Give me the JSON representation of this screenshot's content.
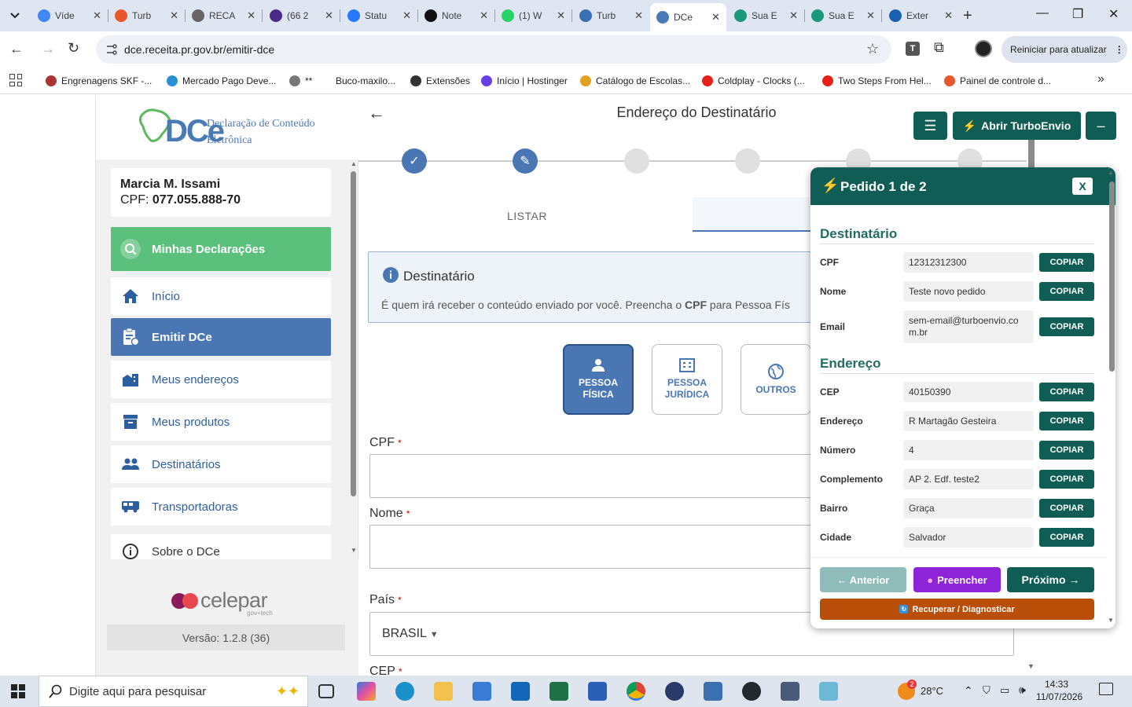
{
  "browser": {
    "tabs": [
      {
        "title": "Víde",
        "color": "#4285f4"
      },
      {
        "title": "Turb",
        "color": "#e8572a"
      },
      {
        "title": "RECA",
        "color": "#666666"
      },
      {
        "title": "(66 2",
        "color": "#4b2a8a"
      },
      {
        "title": "Statu",
        "color": "#2979ff"
      },
      {
        "title": "Note",
        "color": "#111111"
      },
      {
        "title": "(1) W",
        "color": "#25d366"
      },
      {
        "title": "Turb",
        "color": "#3b6fb4"
      },
      {
        "title": "DCe",
        "color": "#4a7ab5"
      },
      {
        "title": "Sua E",
        "color": "#1a9a7a"
      },
      {
        "title": "Sua E",
        "color": "#1a9a7a"
      },
      {
        "title": "Exter",
        "color": "#1a5fb4"
      }
    ],
    "url": "dce.receita.pr.gov.br/emitir-dce",
    "update_label": "Reiniciar para atualizar",
    "bookmarks": [
      {
        "label": "Engrenagens SKF -...",
        "color": "#a33"
      },
      {
        "label": "Mercado Pago Deve...",
        "color": "#2a8fd6"
      },
      {
        "label": "**",
        "color": "#777"
      },
      {
        "label": "Buco-maxilo...",
        "color": "#999"
      },
      {
        "label": "Extensões",
        "color": "#333"
      },
      {
        "label": "Início | Hostinger",
        "color": "#673de6"
      },
      {
        "label": "Catálogo de Escolas...",
        "color": "#e0a020"
      },
      {
        "label": "Coldplay - Clocks (...",
        "color": "#e62117"
      },
      {
        "label": "Two Steps From Hel...",
        "color": "#e62117"
      },
      {
        "label": "Painel de controle d...",
        "color": "#e8572a"
      }
    ]
  },
  "sidebar": {
    "logo_text": "DCe",
    "logo_sub_1": "Declaração de Conteúdo",
    "logo_sub_2": "Eletrônica",
    "user_name": "Marcia M. Issami",
    "user_cpf_label": "CPF:",
    "user_cpf": "077.055.888-70",
    "items": [
      {
        "label": "Minhas Declarações",
        "icon": "search-icon"
      },
      {
        "label": "Início",
        "icon": "home-icon"
      },
      {
        "label": "Emitir DCe",
        "icon": "clipboard-icon"
      },
      {
        "label": "Meus endereços",
        "icon": "building-icon"
      },
      {
        "label": "Meus produtos",
        "icon": "box-icon"
      },
      {
        "label": "Destinatários",
        "icon": "people-icon"
      },
      {
        "label": "Transportadoras",
        "icon": "truck-icon"
      },
      {
        "label": "Sobre o DCe",
        "icon": "info-icon"
      }
    ],
    "celepar": "celepar",
    "celepar_sub": "gov+tech",
    "version": "Versão: 1.2.8 (36)"
  },
  "main": {
    "title": "Endereço do Destinatário",
    "tab_listar": "LISTAR",
    "info_title": "Destinatário",
    "info_desc_1": "É quem irá receber o conteúdo enviado por você. Preencha o ",
    "info_desc_bold": "CPF",
    "info_desc_2": " para Pessoa Fís",
    "type_pf_1": "PESSOA",
    "type_pf_2": "FÍSICA",
    "type_pj_1": "PESSOA",
    "type_pj_2": "JURÍDICA",
    "type_outros": "OUTROS",
    "label_cpf": "CPF",
    "label_nome": "Nome",
    "label_pais": "País",
    "pais_value": "BRASIL",
    "label_cep": "CEP",
    "req": "*"
  },
  "turbo": {
    "open_label": "Abrir TurboEnvio",
    "min_label": "–",
    "panel_title": "Pedido 1 de 2",
    "close_label": "X",
    "sec_dest": "Destinatário",
    "sec_end": "Endereço",
    "copy_label": "COPIAR",
    "dest_rows": [
      {
        "label": "CPF",
        "value": "12312312300"
      },
      {
        "label": "Nome",
        "value": "Teste novo pedido"
      },
      {
        "label": "Email",
        "value": "sem-email@turboenvio.com.br"
      }
    ],
    "end_rows": [
      {
        "label": "CEP",
        "value": "40150390"
      },
      {
        "label": "Endereço",
        "value": "R Martagão Gesteira"
      },
      {
        "label": "Número",
        "value": "4"
      },
      {
        "label": "Complemento",
        "value": "AP 2. Edf. teste2"
      },
      {
        "label": "Bairro",
        "value": "Graça"
      },
      {
        "label": "Cidade",
        "value": "Salvador"
      }
    ],
    "btn_prev": "← Anterior",
    "btn_fill": "Preencher",
    "btn_next": "Próximo →",
    "btn_recover": "Recuperar / Diagnosticar"
  },
  "taskbar": {
    "search_placeholder": "Digite aqui para pesquisar",
    "temp": "28°C",
    "weather_badge": "2",
    "time": "14:33",
    "date": "11/07/2026"
  }
}
